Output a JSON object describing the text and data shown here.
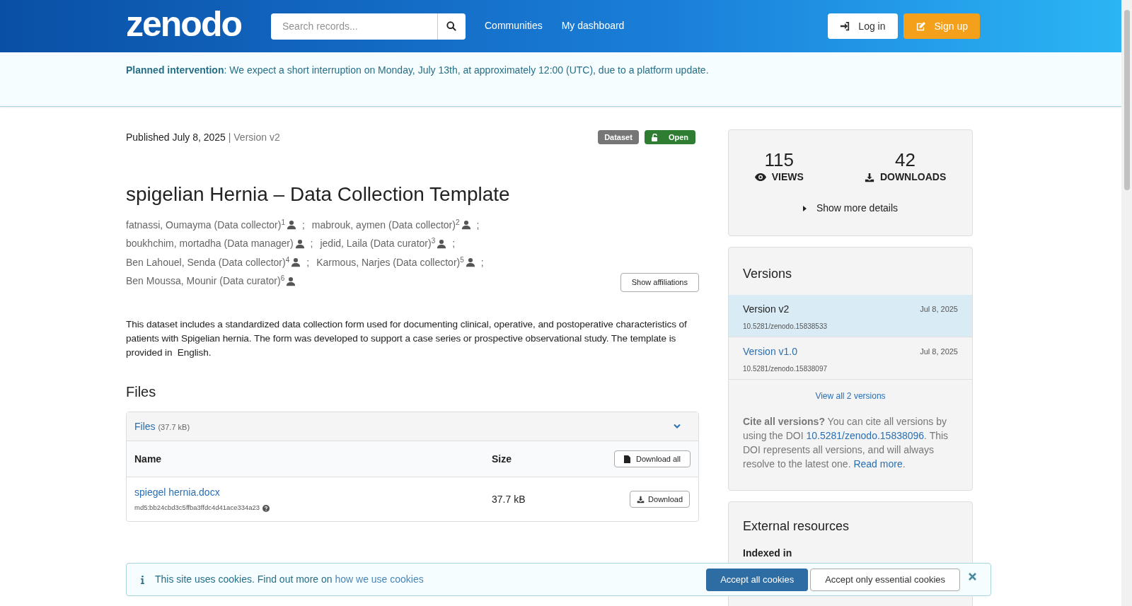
{
  "header": {
    "logo": "zenodo",
    "search": {
      "placeholder": "Search records..."
    },
    "nav": [
      "Communities",
      "My dashboard"
    ],
    "login": "Log in",
    "signup": "Sign up"
  },
  "notice": {
    "title": "Planned intervention",
    "text": ": We expect a short interruption on Monday, July 13th, at approximately 12:00 (UTC), due to a platform update."
  },
  "record": {
    "published": "Published July 8, 2025",
    "separator": "|",
    "version": "Version v2",
    "badges": [
      {
        "label": "Dataset",
        "kind": "type"
      },
      {
        "label": "Open",
        "kind": "access"
      }
    ],
    "title": "spigelian Hernia – Data Collection Template",
    "author_lines": [
      [
        {
          "name": "fatnassi, Oumayma (Data collector)",
          "sup": "1",
          "separator": ";"
        },
        {
          "name": "mabrouk, aymen (Data collector)",
          "sup": "2",
          "separator": ";"
        }
      ],
      [
        {
          "name": "boukhchim, mortadha (Data manager)",
          "separator": ";"
        },
        {
          "name": "jedid, Laila (Data curator)",
          "sup": "3",
          "separator": ";"
        }
      ],
      [
        {
          "name": "Ben Lahouel, Senda (Data collector)",
          "sup": "4",
          "separator": ";"
        },
        {
          "name": "Karmous, Narjes (Data collector)",
          "sup": "5",
          "separator": ";"
        }
      ],
      [
        {
          "name": "Ben Moussa, Mounir (Data curator)",
          "sup": "6"
        }
      ]
    ],
    "affiliations_button": "Show affiliations",
    "description": "This dataset includes a standardized data collection form used for documenting clinical, operative, and postoperative characteristics of patients with Spigelian hernia. The form was developed to support a case series or prospective observational study. The template is provided in  English."
  },
  "files": {
    "heading": "Files",
    "panel_title": "Files",
    "panel_size": "(37.7 kB)",
    "expanded": true,
    "columns": [
      "Name",
      "Size"
    ],
    "download_all": "Download all",
    "rows": [
      {
        "name": "spiegel hernia.docx",
        "checksum": "md5:bb24cbd3c5ffba3ffdc4d41ace334a23",
        "size": "37.7 kB",
        "action": "Download"
      }
    ]
  },
  "stats": {
    "views": "115",
    "views_label": "VIEWS",
    "downloads": "42",
    "downloads_label": "DOWNLOADS",
    "more": "Show more details"
  },
  "versions": {
    "heading": "Versions",
    "items": [
      {
        "label": "Version v2",
        "date": "Jul 8, 2025",
        "doi": "10.5281/zenodo.15838533",
        "selected": true
      },
      {
        "label": "Version v1.0",
        "date": "Jul 8, 2025",
        "doi": "10.5281/zenodo.15838097",
        "selected": false
      }
    ],
    "view_all": "View all 2 versions",
    "cite_bold": "Cite all versions?",
    "cite_text": " You can cite all versions by using the DOI ",
    "cite_doi": "10.5281/zenodo.15838096",
    "cite_text2": ". This DOI represents all versions, and will always resolve to the latest one. ",
    "read_more": "Read more",
    "cite_end": "."
  },
  "external": {
    "heading": "External resources",
    "subheading": "Indexed in"
  },
  "cookies": {
    "text": "This site uses cookies. Find out more on ",
    "link": "how we use cookies",
    "accept_all": "Accept all cookies",
    "accept_essential": "Accept only essential cookies"
  }
}
